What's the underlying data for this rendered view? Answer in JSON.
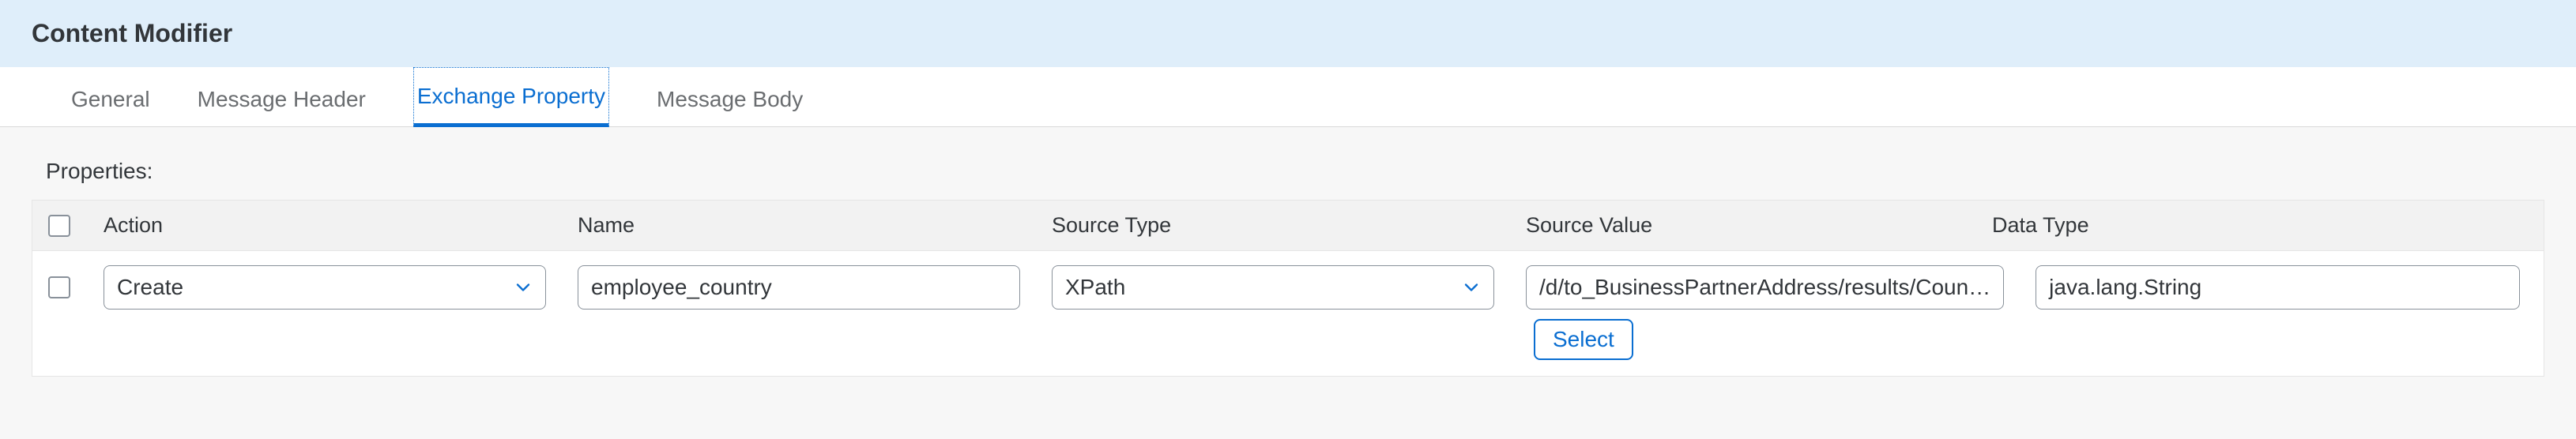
{
  "header": {
    "title": "Content Modifier"
  },
  "tabs": [
    {
      "label": "General"
    },
    {
      "label": "Message Header"
    },
    {
      "label": "Exchange Property"
    },
    {
      "label": "Message Body"
    }
  ],
  "section": {
    "properties_label": "Properties:"
  },
  "columns": {
    "action": "Action",
    "name": "Name",
    "source_type": "Source Type",
    "source_value": "Source Value",
    "data_type": "Data Type"
  },
  "row": {
    "action": "Create",
    "name": "employee_country",
    "source_type": "XPath",
    "source_value": "/d/to_BusinessPartnerAddress/results/Coun…",
    "data_type": "java.lang.String",
    "select_button": "Select"
  }
}
